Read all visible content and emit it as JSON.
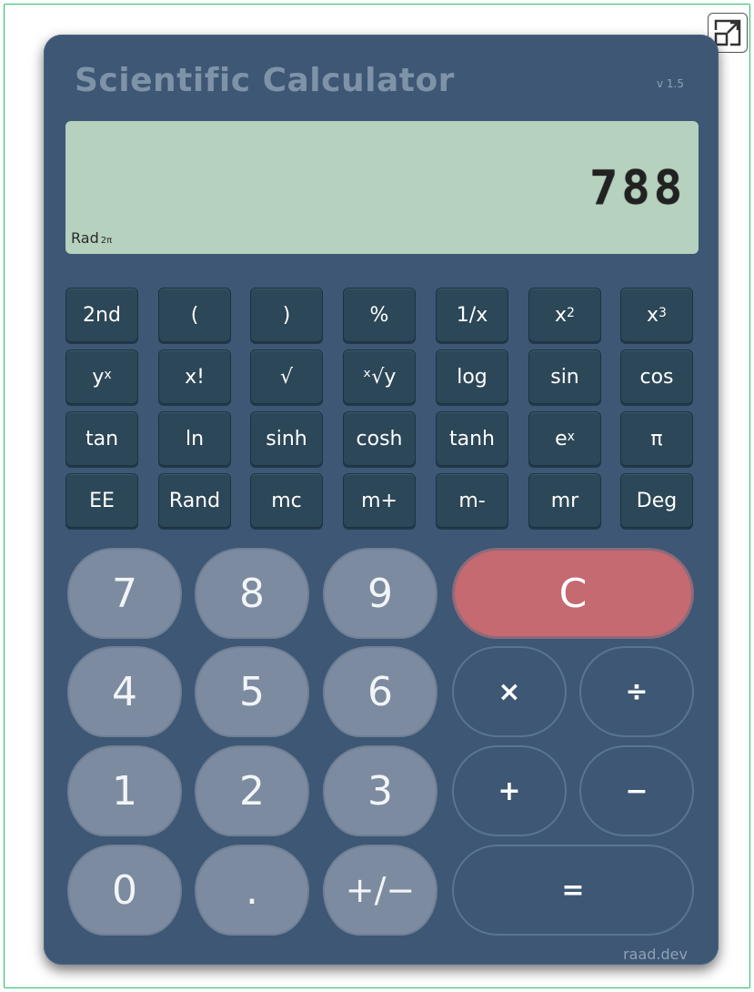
{
  "app": {
    "title": "Scientific Calculator",
    "version": "v 1.5",
    "brand": "raad.dev"
  },
  "display": {
    "value": "788",
    "mode": "Rad",
    "mode_sub": "2π"
  },
  "function_keys": {
    "row1": [
      "2nd",
      "(",
      ")",
      "%",
      "1/x",
      "x",
      "x"
    ],
    "row1_sup": [
      "",
      "",
      "",
      "",
      "",
      "2",
      "3"
    ],
    "row2": [
      "y",
      "x!",
      "√",
      "ˣ√y",
      "log",
      "sin",
      "cos"
    ],
    "row2_sup": [
      "x",
      "",
      "",
      "",
      "",
      "",
      ""
    ],
    "row3": [
      "tan",
      "ln",
      "sinh",
      "cosh",
      "tanh",
      "e",
      "π"
    ],
    "row3_sup": [
      "",
      "",
      "",
      "",
      "",
      "x",
      ""
    ],
    "row4": [
      "EE",
      "Rand",
      "mc",
      "m+",
      "m-",
      "mr",
      "Deg"
    ]
  },
  "keypad": {
    "digits": [
      "7",
      "8",
      "9",
      "4",
      "5",
      "6",
      "1",
      "2",
      "3",
      "0",
      ".",
      "+/−"
    ],
    "clear": "C",
    "multiply": "×",
    "divide": "÷",
    "plus": "+",
    "minus": "−",
    "equals": "="
  },
  "colors": {
    "body": "#3d5774",
    "display": "#b6d1be",
    "clear": "#c46a70",
    "digit": "#7c8b9f",
    "frame": "#27c06a"
  },
  "icons": {
    "expand": "expand-icon"
  }
}
